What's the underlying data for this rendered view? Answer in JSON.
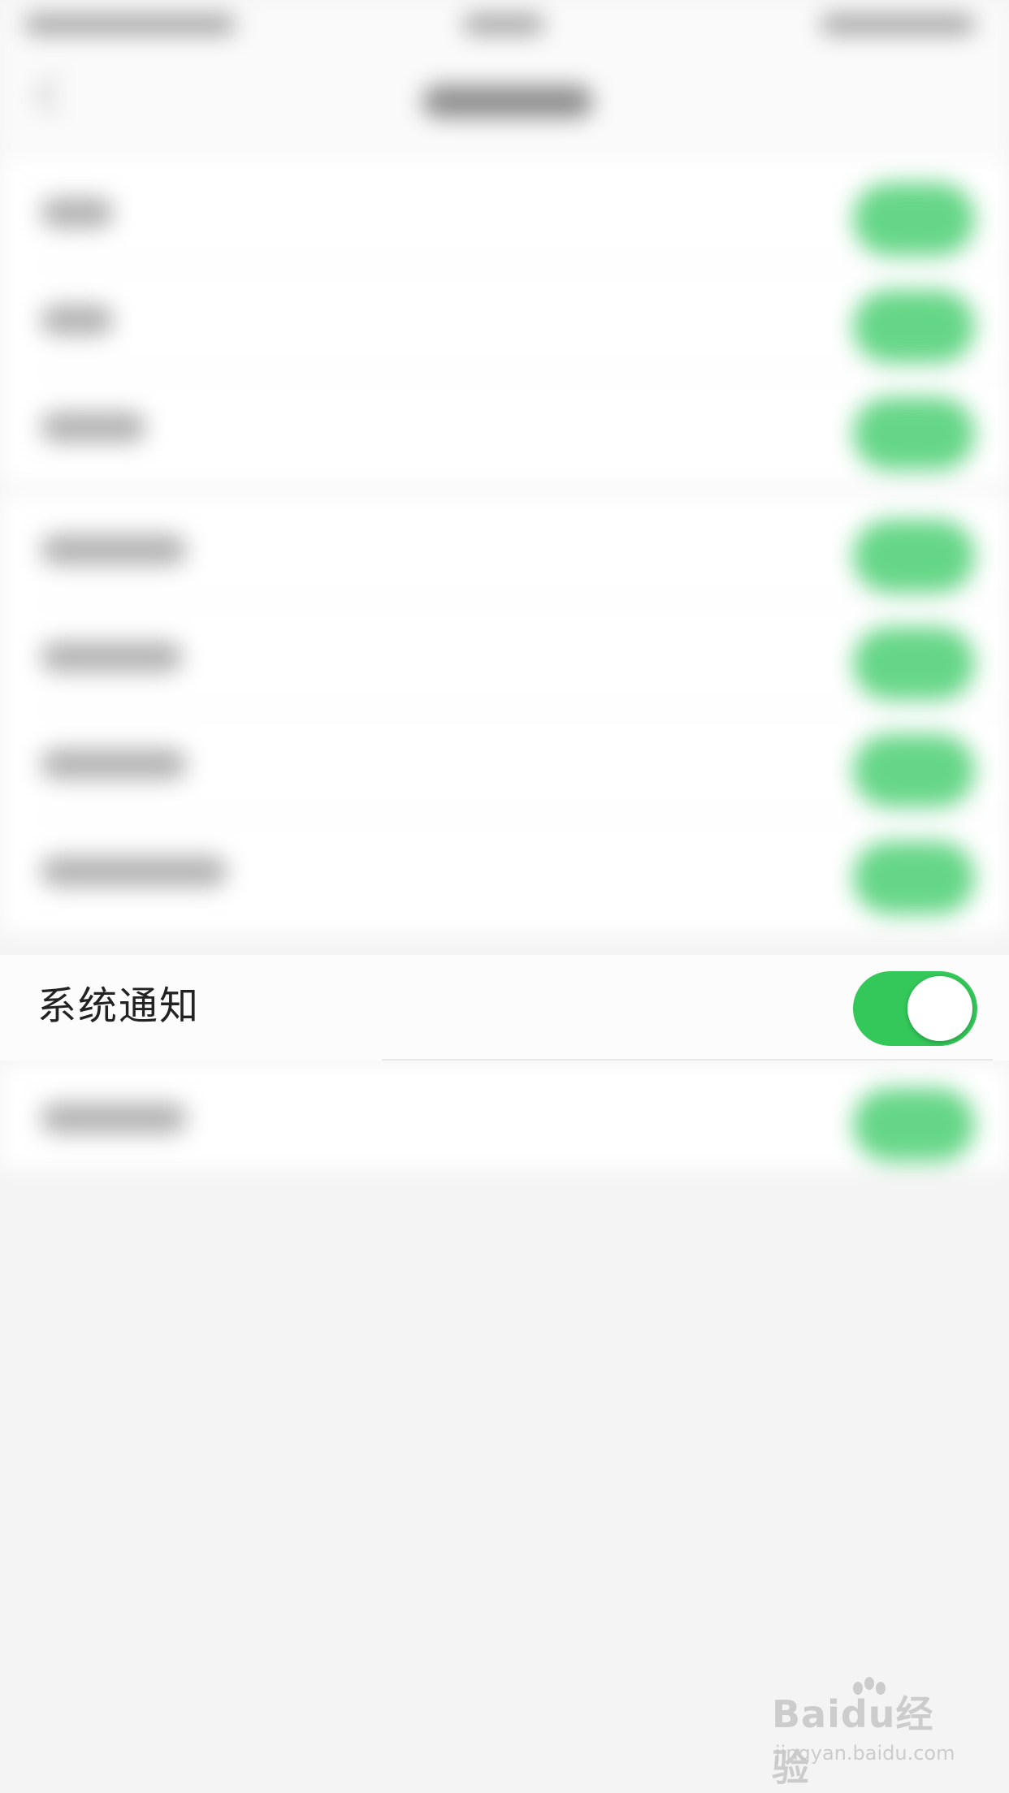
{
  "settings": {
    "highlighted_item": {
      "label": "系统通知",
      "toggle_on": true
    }
  },
  "colors": {
    "toggle_on": "#34c759",
    "background": "#f4f4f4",
    "row_background": "#ffffff"
  },
  "watermark": {
    "main": "Baidu经验",
    "sub": "jingyan.baidu.com"
  }
}
